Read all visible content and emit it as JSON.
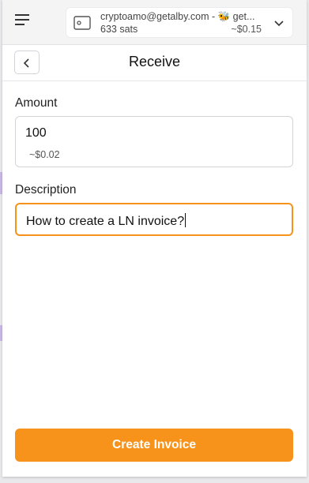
{
  "account": {
    "name": "cryptoamo@getalby.com - 🐝 get...",
    "balance_sats": "633 sats",
    "balance_fiat": "~$0.15"
  },
  "header": {
    "title": "Receive"
  },
  "form": {
    "amount_label": "Amount",
    "amount_value": "100",
    "amount_fiat": "~$0.02",
    "description_label": "Description",
    "description_value": "How to create a LN invoice?"
  },
  "actions": {
    "create_invoice_label": "Create Invoice"
  },
  "colors": {
    "accent": "#f7931a"
  }
}
